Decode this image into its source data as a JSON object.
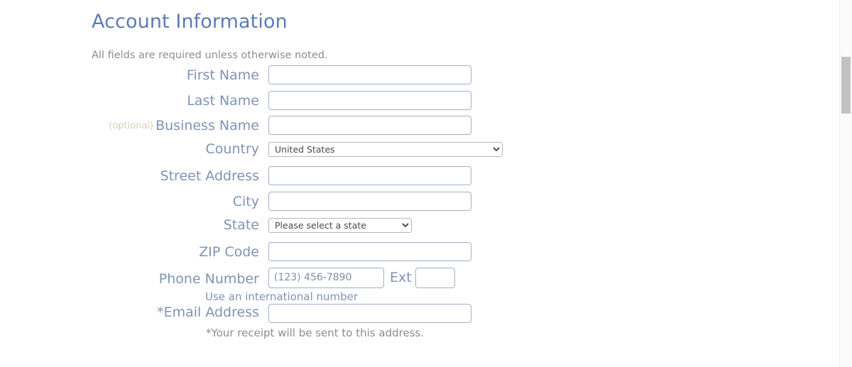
{
  "page": {
    "title": "Account Information",
    "intro_note": "All fields are required unless otherwise noted."
  },
  "form": {
    "first_name": {
      "label": "First Name",
      "value": "",
      "placeholder": ""
    },
    "last_name": {
      "label": "Last Name",
      "value": "",
      "placeholder": ""
    },
    "business_name": {
      "optional_tag": "(optional)",
      "label": "Business Name",
      "value": "",
      "placeholder": ""
    },
    "country": {
      "label": "Country",
      "selected": "United States",
      "options": [
        "United States"
      ]
    },
    "street_address": {
      "label": "Street Address",
      "value": "",
      "placeholder": ""
    },
    "city": {
      "label": "City",
      "value": "",
      "placeholder": ""
    },
    "state": {
      "label": "State",
      "selected": "Please select a state",
      "options": [
        "Please select a state"
      ]
    },
    "zip_code": {
      "label": "ZIP Code",
      "value": "",
      "placeholder": ""
    },
    "phone": {
      "label": "Phone Number",
      "value": "",
      "placeholder": "(123) 456-7890",
      "ext_label": "Ext",
      "ext_value": "",
      "international_link": "Use an international number"
    },
    "email": {
      "label": "*Email Address",
      "value": "",
      "placeholder": "",
      "receipt_note": "*Your receipt will be sent to this address."
    }
  },
  "scrollbar": {
    "orientation": "vertical"
  },
  "colors": {
    "heading": "#5b7bb5",
    "label": "#7f93b5",
    "optional_tag": "#d6cfae",
    "note": "#8d8d8d",
    "input_border": "#9fb0cc",
    "select_border": "#b6b6bd",
    "scrollbar_thumb": "#c2c2c2",
    "background": "#ffffff"
  }
}
